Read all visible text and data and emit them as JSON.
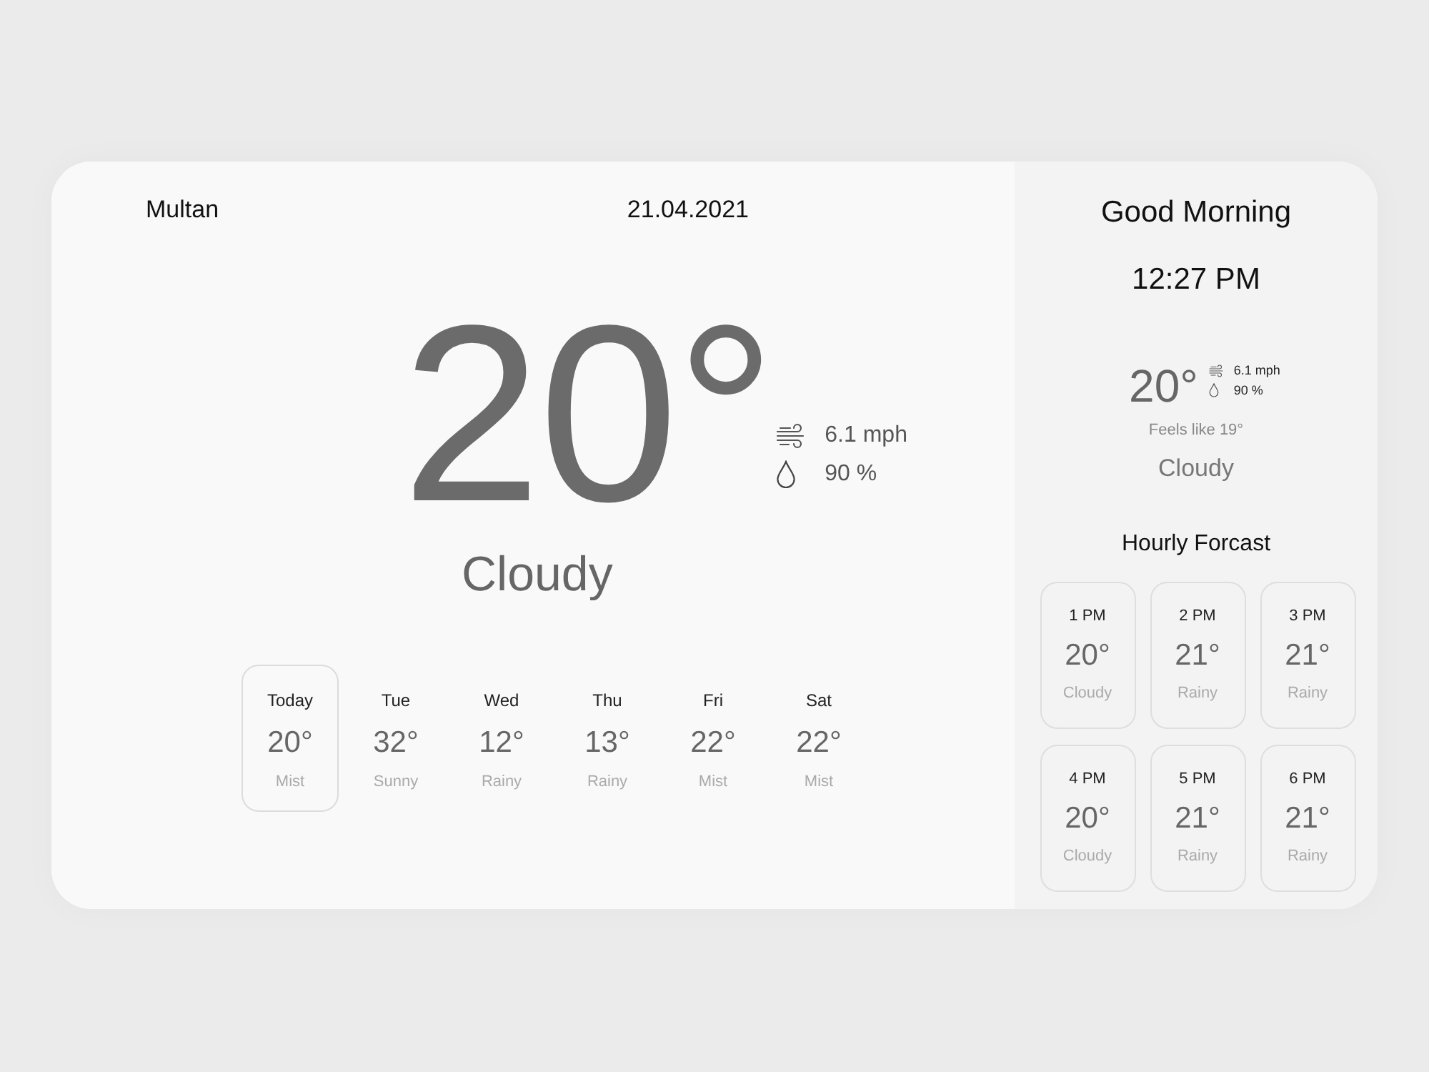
{
  "location": "Multan",
  "date": "21.04.2021",
  "current": {
    "temperature": "20°",
    "wind": "6.1 mph",
    "humidity": "90 %",
    "condition": "Cloudy"
  },
  "days": [
    {
      "day": "Today",
      "temperature": "20°",
      "condition": "Mist",
      "selected": true
    },
    {
      "day": "Tue",
      "temperature": "32°",
      "condition": "Sunny",
      "selected": false
    },
    {
      "day": "Wed",
      "temperature": "12°",
      "condition": "Rainy",
      "selected": false
    },
    {
      "day": "Thu",
      "temperature": "13°",
      "condition": "Rainy",
      "selected": false
    },
    {
      "day": "Fri",
      "temperature": "22°",
      "condition": "Mist",
      "selected": false
    },
    {
      "day": "Sat",
      "temperature": "22°",
      "condition": "Mist",
      "selected": false
    }
  ],
  "sidebar": {
    "greeting": "Good Morning",
    "time": "12:27 PM",
    "temperature": "20°",
    "wind": "6.1 mph",
    "humidity": "90 %",
    "feels_like": "Feels like 19°",
    "condition": "Cloudy",
    "hourly_title": "Hourly Forcast",
    "hourly": [
      {
        "time": "1 PM",
        "temperature": "20°",
        "condition": "Cloudy"
      },
      {
        "time": "2 PM",
        "temperature": "21°",
        "condition": "Rainy"
      },
      {
        "time": "3 PM",
        "temperature": "21°",
        "condition": "Rainy"
      },
      {
        "time": "4 PM",
        "temperature": "20°",
        "condition": "Cloudy"
      },
      {
        "time": "5 PM",
        "temperature": "21°",
        "condition": "Rainy"
      },
      {
        "time": "6 PM",
        "temperature": "21°",
        "condition": "Rainy"
      }
    ]
  }
}
